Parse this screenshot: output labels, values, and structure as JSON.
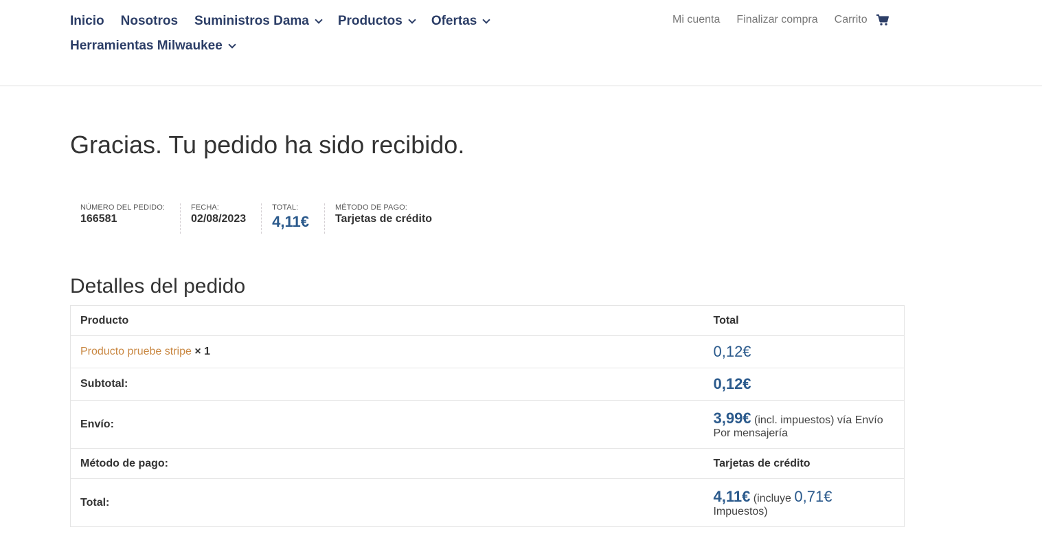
{
  "nav": {
    "main": [
      {
        "label": "Inicio",
        "has_dropdown": false
      },
      {
        "label": "Nosotros",
        "has_dropdown": false
      },
      {
        "label": "Suministros Dama",
        "has_dropdown": true
      },
      {
        "label": "Productos",
        "has_dropdown": true
      },
      {
        "label": "Ofertas",
        "has_dropdown": true
      },
      {
        "label": "Herramientas Milwaukee",
        "has_dropdown": true
      }
    ],
    "secondary": {
      "account": "Mi cuenta",
      "checkout": "Finalizar compra",
      "cart": "Carrito",
      "cart_icon": "shopping-cart-icon"
    }
  },
  "page": {
    "title": "Gracias. Tu pedido ha sido recibido."
  },
  "overview": {
    "order_number_label": "NÚMERO DEL PEDIDO:",
    "order_number": "166581",
    "date_label": "FECHA:",
    "date": "02/08/2023",
    "total_label": "TOTAL:",
    "total": "4,11€",
    "payment_label": "MÉTODO DE PAGO:",
    "payment": "Tarjetas de crédito"
  },
  "details": {
    "heading": "Detalles del pedido",
    "col_product": "Producto",
    "col_total": "Total",
    "item": {
      "name": "Producto pruebe stripe",
      "qty": "× 1",
      "price": "0,12€"
    },
    "subtotal_label": "Subtotal:",
    "subtotal": "0,12€",
    "shipping_label": "Envío:",
    "shipping_price": "3,99€",
    "shipping_note_1": "(incl. impuestos) vía Envío",
    "shipping_note_2": "Por mensajería",
    "payment_label": "Método de pago:",
    "payment": "Tarjetas de crédito",
    "total_label": "Total:",
    "total": "4,11€",
    "total_note_prefix": "(incluye",
    "tax_amount": "0,71€",
    "total_note_suffix": "Impuestos)"
  },
  "colors": {
    "nav": "#2c3e67",
    "price": "#2b5a8c",
    "link": "#c98843"
  }
}
